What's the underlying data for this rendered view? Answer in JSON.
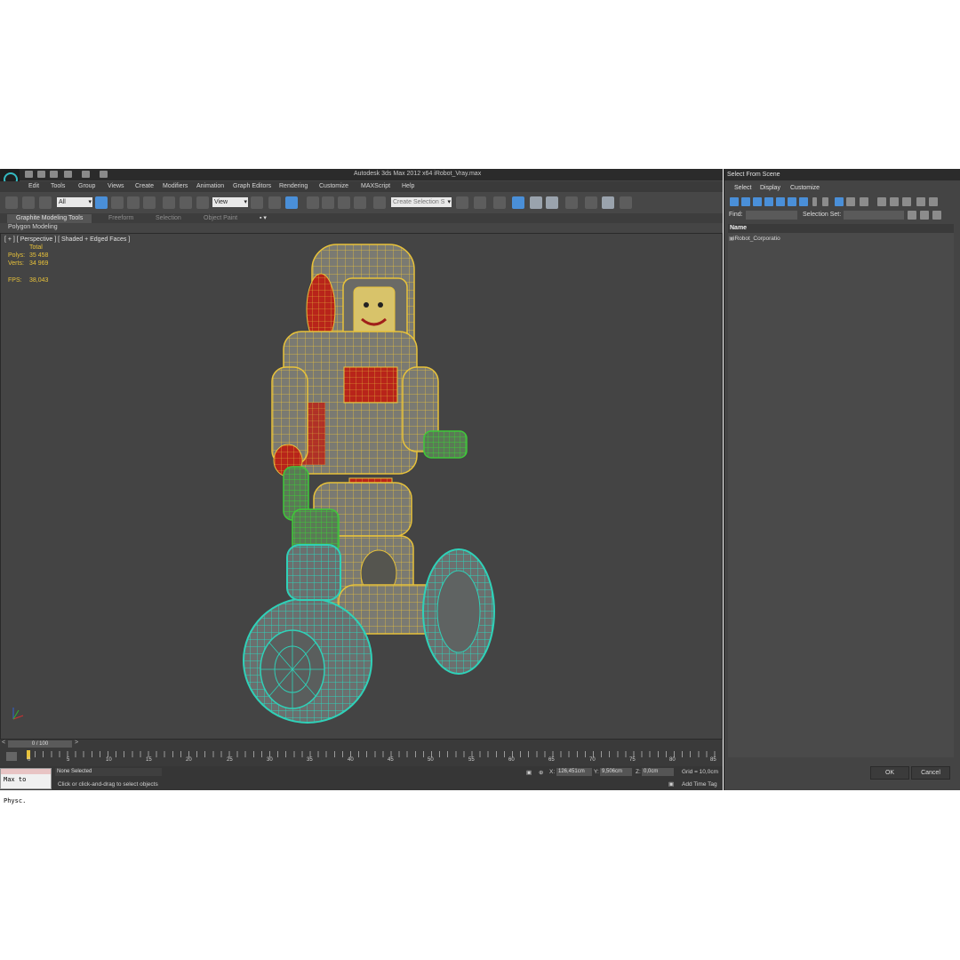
{
  "app": {
    "title": "Autodesk 3ds Max  2012 x64     iRobot_Vray.max"
  },
  "menu": [
    "Edit",
    "Tools",
    "Group",
    "Views",
    "Create",
    "Modifiers",
    "Animation",
    "Graph Editors",
    "Rendering",
    "Customize",
    "MAXScript",
    "Help"
  ],
  "toolbar": {
    "filter_value": "All",
    "ref_coord_value": "View",
    "selection_set_placeholder": "Create Selection S"
  },
  "ribbon": {
    "tabs": [
      "Graphite Modeling Tools",
      "Freeform",
      "Selection",
      "Object Paint"
    ],
    "panel": "Polygon Modeling"
  },
  "viewport": {
    "label": "[ + ] [ Perspective ] [ Shaded + Edged Faces ]",
    "stats_header": "Total",
    "polys_label": "Polys:",
    "polys_value": "35 458",
    "verts_label": "Verts:",
    "verts_value": "34 969",
    "fps_label": "FPS:",
    "fps_value": "38,043"
  },
  "timeline": {
    "slider": "0 / 100",
    "ticks": [
      "0",
      "5",
      "10",
      "15",
      "20",
      "25",
      "30",
      "35",
      "40",
      "45",
      "50",
      "55",
      "60",
      "65",
      "70",
      "75",
      "80",
      "85"
    ]
  },
  "status": {
    "selection": "None Selected",
    "prompt": "Click or click-and-drag to select objects",
    "x_label": "X:",
    "x_value": "126,451cm",
    "y_label": "Y:",
    "y_value": "9,506cm",
    "z_label": "Z:",
    "z_value": "0,0cm",
    "grid": "Grid = 10,0cm",
    "add_time_tag": "Add Time Tag",
    "maxscript": "Max to Physc."
  },
  "dialog": {
    "title": "Select From Scene",
    "menu": [
      "Select",
      "Display",
      "Customize"
    ],
    "find_label": "Find:",
    "selection_set_label": "Selection Set:",
    "column": "Name",
    "items": [
      "iRobot_Corporatio"
    ],
    "ok": "OK",
    "cancel": "Cancel"
  },
  "colors": {
    "viewport_bg": "#444444",
    "wire_yellow": "#e8c23a",
    "wire_cyan": "#2fd1b8",
    "wire_green": "#3fc83a",
    "accent_blue": "#4a8fd8"
  }
}
